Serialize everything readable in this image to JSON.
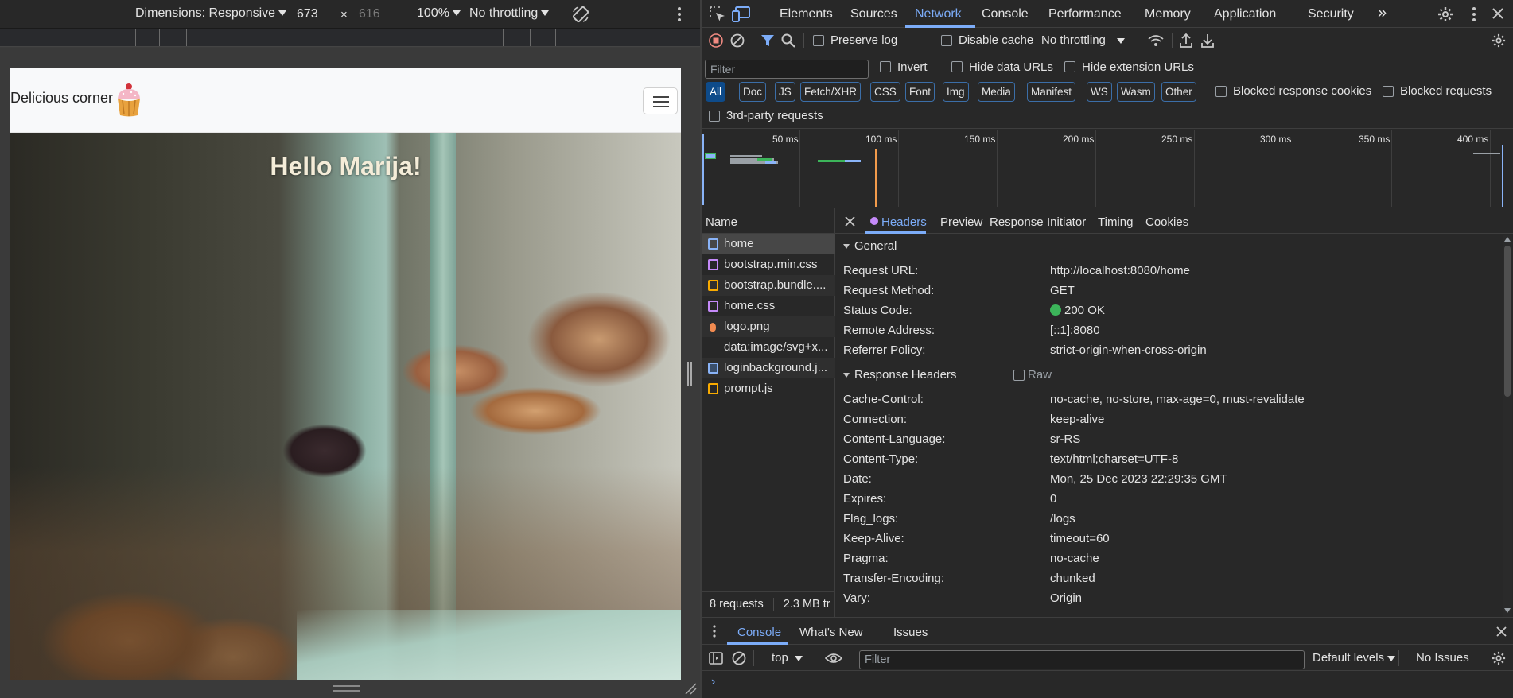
{
  "device_toolbar": {
    "dimensions_label": "Dimensions: Responsive",
    "width": "673",
    "times": "×",
    "height": "616",
    "zoom": "100%",
    "throttling": "No throttling"
  },
  "page": {
    "brand": "Delicious corner",
    "hero_title": "Hello Marija!"
  },
  "devtools": {
    "tabs": [
      "Elements",
      "Sources",
      "Network",
      "Console",
      "Performance",
      "Memory",
      "Application",
      "Security"
    ],
    "active_tab": "Network",
    "more_tabs": "»",
    "network_toolbar": {
      "preserve_log": "Preserve log",
      "disable_cache": "Disable cache",
      "throttling": "No throttling"
    },
    "filter": {
      "placeholder": "Filter",
      "invert": "Invert",
      "hide_data_urls": "Hide data URLs",
      "hide_extension_urls": "Hide extension URLs"
    },
    "types": [
      "All",
      "Doc",
      "JS",
      "Fetch/XHR",
      "CSS",
      "Font",
      "Img",
      "Media",
      "Manifest",
      "WS",
      "Wasm",
      "Other"
    ],
    "blocked_response_cookies": "Blocked response cookies",
    "blocked_requests": "Blocked requests",
    "third_party": "3rd-party requests",
    "timeline_ticks": [
      "50 ms",
      "100 ms",
      "150 ms",
      "200 ms",
      "250 ms",
      "300 ms",
      "350 ms",
      "400 ms"
    ],
    "name_header": "Name",
    "requests": [
      {
        "name": "home",
        "icon_color": "#8ab4f8",
        "icon": "doc-icon"
      },
      {
        "name": "bootstrap.min.css",
        "icon_color": "#c58af9",
        "icon": "css-icon"
      },
      {
        "name": "bootstrap.bundle....",
        "icon_color": "#f9ab00",
        "icon": "js-icon"
      },
      {
        "name": "home.css",
        "icon_color": "#c58af9",
        "icon": "css-icon"
      },
      {
        "name": "logo.png",
        "icon_color": "#f28b50",
        "icon": "image-icon"
      },
      {
        "name": "data:image/svg+x...",
        "icon_color": "",
        "icon": "none"
      },
      {
        "name": "loginbackground.j...",
        "icon_color": "#8ab4f8",
        "icon": "image-icon"
      },
      {
        "name": "prompt.js",
        "icon_color": "#f9ab00",
        "icon": "js-icon"
      }
    ],
    "footer": {
      "requests": "8 requests",
      "transferred": "2.3 MB tr"
    },
    "detail_tabs": [
      "Headers",
      "Preview",
      "Response",
      "Initiator",
      "Timing",
      "Cookies"
    ],
    "general_title": "General",
    "general": [
      {
        "k": "Request URL:",
        "v": "http://localhost:8080/home"
      },
      {
        "k": "Request Method:",
        "v": "GET"
      },
      {
        "k": "Status Code:",
        "v": "200 OK"
      },
      {
        "k": "Remote Address:",
        "v": "[::1]:8080"
      },
      {
        "k": "Referrer Policy:",
        "v": "strict-origin-when-cross-origin"
      }
    ],
    "response_headers_title": "Response Headers",
    "raw_label": "Raw",
    "response_headers": [
      {
        "k": "Cache-Control:",
        "v": "no-cache, no-store, max-age=0, must-revalidate"
      },
      {
        "k": "Connection:",
        "v": "keep-alive"
      },
      {
        "k": "Content-Language:",
        "v": "sr-RS"
      },
      {
        "k": "Content-Type:",
        "v": "text/html;charset=UTF-8"
      },
      {
        "k": "Date:",
        "v": "Mon, 25 Dec 2023 22:29:35 GMT"
      },
      {
        "k": "Expires:",
        "v": "0"
      },
      {
        "k": "Flag_logs:",
        "v": "/logs"
      },
      {
        "k": "Keep-Alive:",
        "v": "timeout=60"
      },
      {
        "k": "Pragma:",
        "v": "no-cache"
      },
      {
        "k": "Transfer-Encoding:",
        "v": "chunked"
      },
      {
        "k": "Vary:",
        "v": "Origin"
      }
    ],
    "drawer": {
      "tabs": [
        "Console",
        "What's New",
        "Issues"
      ],
      "context": "top",
      "filter_placeholder": "Filter",
      "levels": "Default levels",
      "issues": "No Issues",
      "prompt": "›"
    }
  }
}
